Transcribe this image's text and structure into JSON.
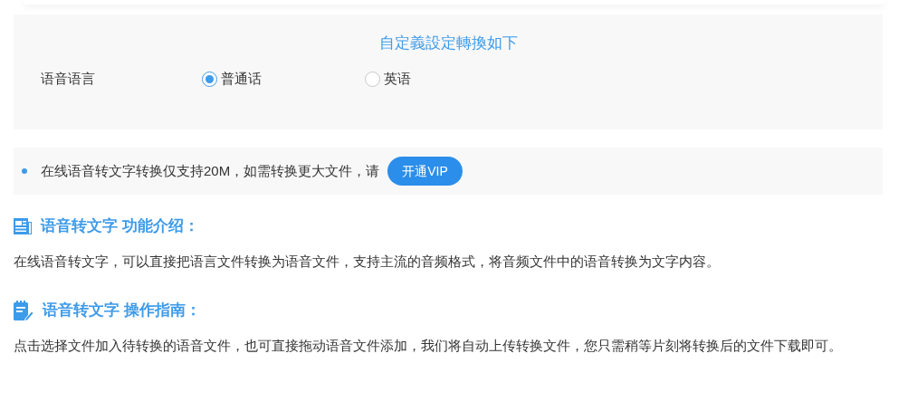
{
  "settings": {
    "title": "自定義設定轉換如下",
    "field_label": "语音语言",
    "options": [
      {
        "label": "普通话",
        "selected": true
      },
      {
        "label": "英语",
        "selected": false
      }
    ]
  },
  "notice": {
    "text": "在线语音转文字转换仅支持20M，如需转换更大文件，请",
    "button": "开通VIP"
  },
  "sections": [
    {
      "kind": "intro",
      "heading": "语音转文字 功能介绍：",
      "body": "在线语音转文字，可以直接把语言文件转换为语音文件，支持主流的音频格式，将音频文件中的语音转换为文字内容。"
    },
    {
      "kind": "guide",
      "heading": "语音转文字 操作指南：",
      "body": "点击选择文件加入待转换的语音文件，也可直接拖动语音文件添加，我们将自动上传转换文件，您只需稍等片刻将转换后的文件下载即可。"
    }
  ]
}
